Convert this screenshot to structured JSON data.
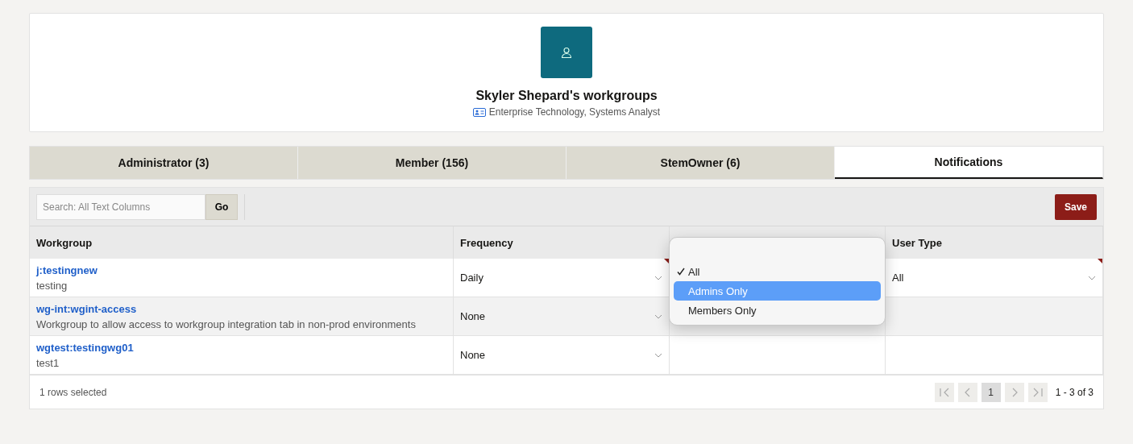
{
  "profile": {
    "title": "Skyler Shepard's workgroups",
    "subtitle": "Enterprise Technology, Systems Analyst"
  },
  "tabs": [
    {
      "label": "Administrator (3)",
      "selected": false
    },
    {
      "label": "Member (156)",
      "selected": false
    },
    {
      "label": "StemOwner (6)",
      "selected": false
    },
    {
      "label": "Notifications",
      "selected": true
    }
  ],
  "toolbar": {
    "search": {
      "placeholder": "Search: All Text Columns"
    },
    "go": "Go",
    "save": "Save"
  },
  "table": {
    "columns": [
      "Workgroup",
      "Frequency",
      "User Type"
    ],
    "rows": [
      {
        "name": "j:testingnew",
        "description": "testing",
        "frequency": "Daily",
        "user_type": "All",
        "modified": true,
        "selected": false
      },
      {
        "name": "wg-int:wgint-access",
        "description": "Workgroup to allow access to workgroup integration tab in non-prod environments",
        "frequency": "None",
        "modified": false,
        "selected": true
      },
      {
        "name": "wgtest:testingwg01",
        "description": "test1",
        "frequency": "None",
        "modified": false,
        "selected": false
      }
    ]
  },
  "dropdown": {
    "options": [
      {
        "label": "All",
        "checked": true,
        "selected": false
      },
      {
        "label": "Admins Only",
        "checked": false,
        "selected": true
      },
      {
        "label": "Members Only",
        "checked": false,
        "selected": false
      }
    ]
  },
  "footer": {
    "selection": "1 rows selected",
    "page": "1",
    "range": "1 - 3 of 3"
  }
}
